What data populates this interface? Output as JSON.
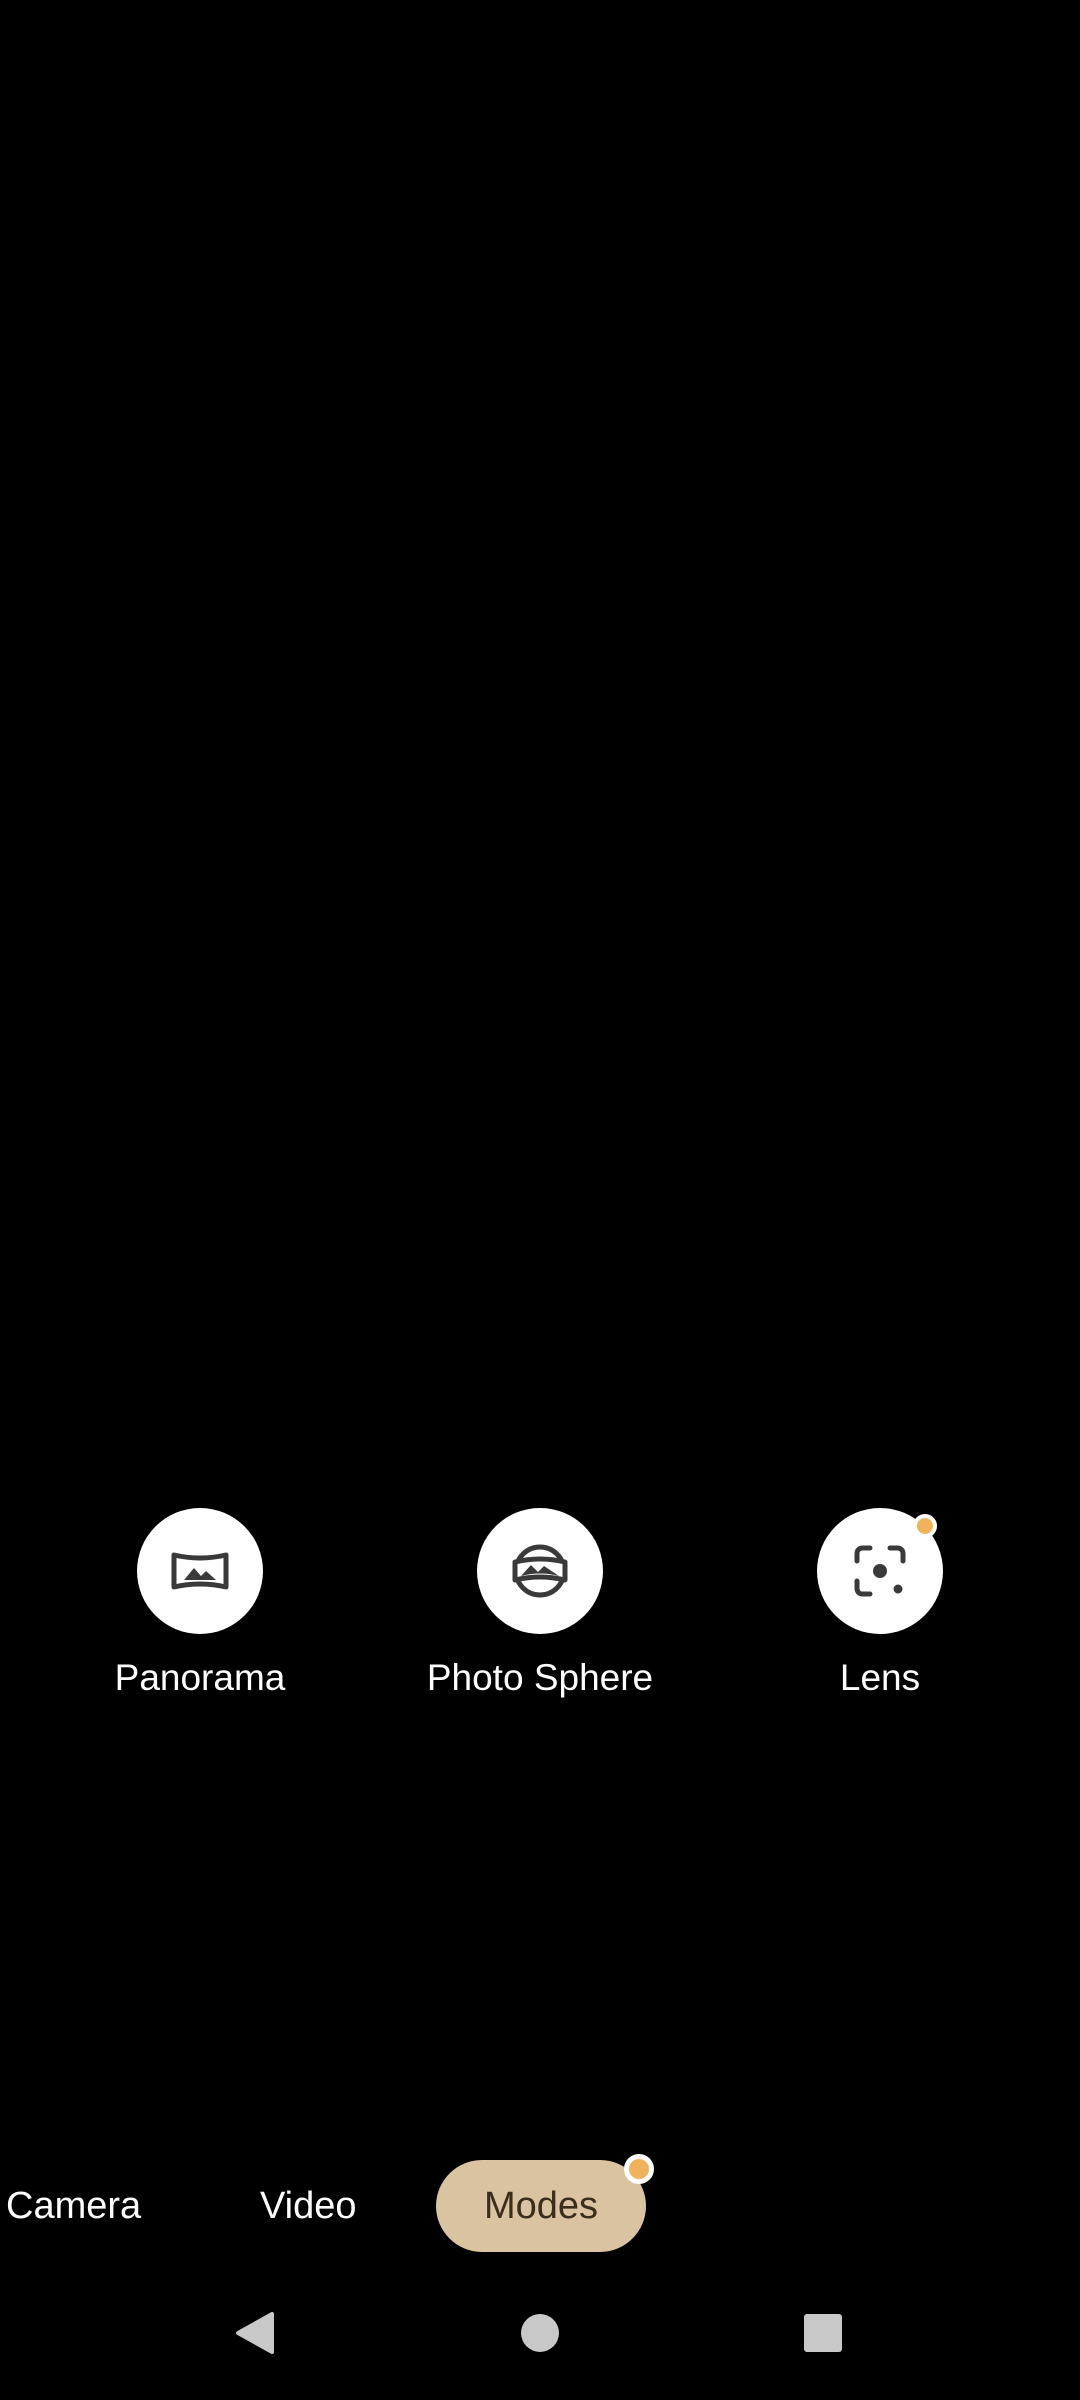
{
  "colors": {
    "background": "#000000",
    "mode_circle": "#ffffff",
    "mode_icon": "#3a3a3a",
    "label_text": "#ffffff",
    "selected_tab_bg": "#d9c3a0",
    "selected_tab_text": "#3b2e1c",
    "new_dot": "#f0b35c",
    "nav_icon": "#c8c8c8"
  },
  "modes": [
    {
      "label": "Panorama",
      "icon": "panorama-icon",
      "has_new_dot": false
    },
    {
      "label": "Photo Sphere",
      "icon": "photo-sphere-icon",
      "has_new_dot": false
    },
    {
      "label": "Lens",
      "icon": "lens-icon",
      "has_new_dot": true
    }
  ],
  "mode_switcher": {
    "tabs": [
      {
        "label": "Camera",
        "selected": false
      },
      {
        "label": "Video",
        "selected": false
      },
      {
        "label": "Modes",
        "selected": true
      }
    ]
  },
  "nav_bar": {
    "back_icon": "back-triangle-icon",
    "home_icon": "home-circle-icon",
    "recents_icon": "recents-square-icon"
  }
}
